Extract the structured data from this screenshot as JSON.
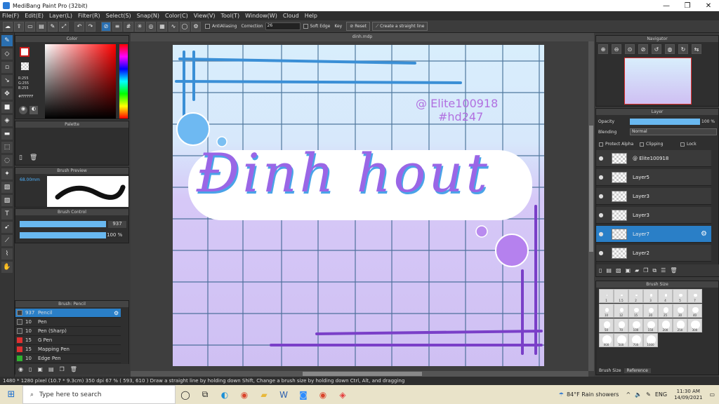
{
  "window": {
    "title": "MediBang Paint Pro (32bit)",
    "min": "—",
    "max": "❐",
    "close": "✕"
  },
  "menu": [
    "File(F)",
    "Edit(E)",
    "Layer(L)",
    "Filter(R)",
    "Select(S)",
    "Snap(N)",
    "Color(C)",
    "View(V)",
    "Tool(T)",
    "Window(W)",
    "Cloud",
    "Help"
  ],
  "toolbar": {
    "antialias": "AntiAliasing",
    "correction_label": "Correction",
    "correction_value": "26",
    "soft_edge": "Soft Edge",
    "key": "Key",
    "reset": "Reset",
    "straight_line": "Create a straight line"
  },
  "panels": {
    "color": "Color",
    "palette": "Palette",
    "brush_preview": "Brush Preview",
    "brush_control": "Brush Control",
    "brush_list": "Brush: Pencil",
    "navigator": "Navigator",
    "layer": "Layer",
    "brush_size": "Brush Size"
  },
  "color_values": {
    "r": "R:255",
    "g": "G:255",
    "b": "B:255",
    "hex": "#FFFFFF"
  },
  "brush_preview_size": "68.00mm",
  "brush_control": {
    "size": "937",
    "opacity": "100 %"
  },
  "brushes": [
    {
      "num": "937",
      "name": "Pencil",
      "color": "#3a3a3a"
    },
    {
      "num": "10",
      "name": "Pen",
      "color": "#3a3a3a"
    },
    {
      "num": "10",
      "name": "Pen (Sharp)",
      "color": "#3a3a3a"
    },
    {
      "num": "15",
      "name": "G Pen",
      "color": "#e03030"
    },
    {
      "num": "15",
      "name": "Mapping Pen",
      "color": "#e03030"
    },
    {
      "num": "10",
      "name": "Edge Pen",
      "color": "#30b030"
    }
  ],
  "doc_tab": "dinh.mdp",
  "artwork": {
    "handle": "@ Elite100918",
    "tag": "#hd247",
    "title": "Ðinh hout"
  },
  "layer_panel": {
    "opacity_label": "Opacity",
    "opacity_value": "100 %",
    "blending_label": "Blending",
    "blending_value": "Normal",
    "protect_alpha": "Protect Alpha",
    "clipping": "Clipping",
    "lock": "Lock"
  },
  "layers": [
    "@ Elite100918",
    "Layer5",
    "Layer3",
    "Layer3",
    "Layer7",
    "Layer2"
  ],
  "brush_sizes": [
    "1",
    "1.5",
    "2",
    "3",
    "4",
    "5",
    "7",
    "10",
    "12",
    "15",
    "20",
    "25",
    "30",
    "40",
    "50",
    "70",
    "100",
    "150",
    "200",
    "250",
    "300",
    "400",
    "500",
    "700",
    "1000"
  ],
  "brush_size_tabs": [
    "Brush Size",
    "Reference"
  ],
  "status": "1480 * 1280 pixel   (10.7 * 9.3cm)  350 dpi   67 %   ( 593, 610 )   Draw a straight line by holding down Shift, Change a brush size by holding down Ctrl, Alt, and dragging",
  "taskbar": {
    "search": "Type here to search",
    "weather": "84°F  Rain showers",
    "lang": "ENG",
    "time": "11:30 AM",
    "date": "14/09/2021"
  }
}
